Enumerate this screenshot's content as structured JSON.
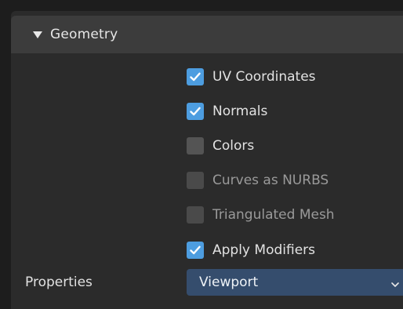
{
  "panel": {
    "title": "Geometry",
    "expanded": true
  },
  "options": [
    {
      "label": "UV Coordinates",
      "checked": true,
      "enabled": true
    },
    {
      "label": "Normals",
      "checked": true,
      "enabled": true
    },
    {
      "label": "Colors",
      "checked": false,
      "enabled": true
    },
    {
      "label": "Curves as NURBS",
      "checked": false,
      "enabled": false
    },
    {
      "label": "Triangulated Mesh",
      "checked": false,
      "enabled": false
    },
    {
      "label": "Apply Modifiers",
      "checked": true,
      "enabled": true
    }
  ],
  "properties": {
    "label": "Properties",
    "value": "Viewport"
  },
  "colors": {
    "accent": "#4d9de0",
    "dropdown": "#354d6d",
    "header": "#3c3c3c",
    "panel": "#2b2b2b"
  },
  "icons": {
    "disclosure": "triangle-down-icon",
    "check": "check-icon",
    "dropdown": "chevron-down-icon"
  }
}
